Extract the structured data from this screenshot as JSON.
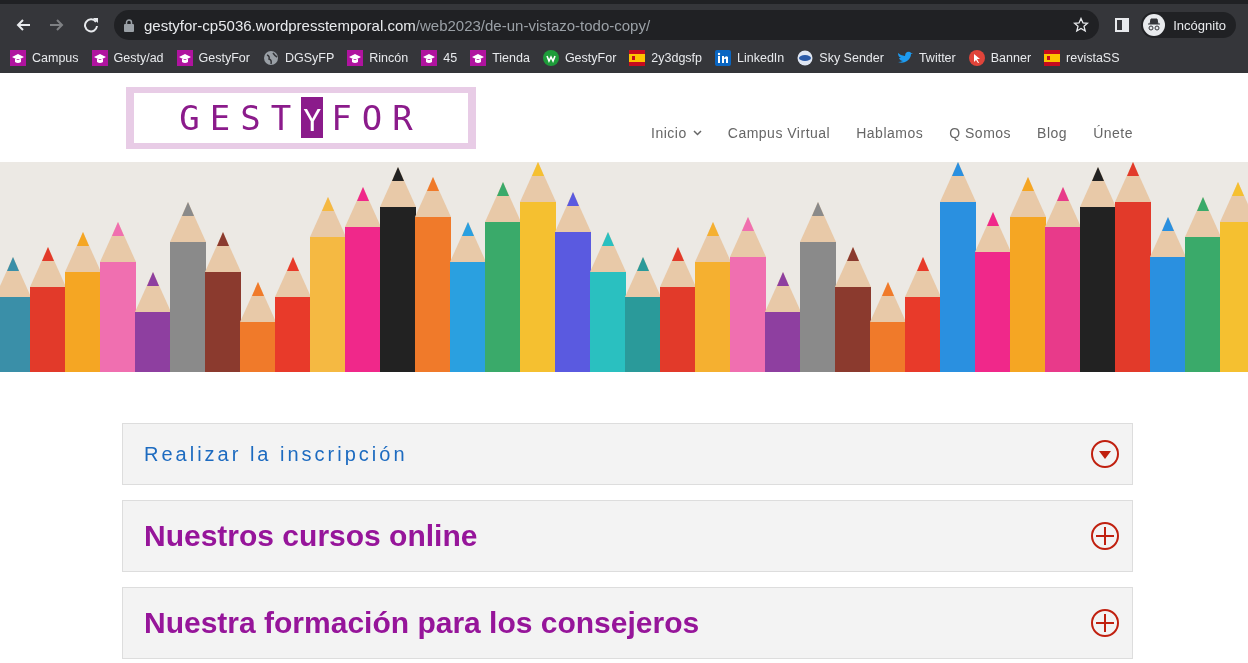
{
  "browser": {
    "url_host": "gestyfor-cp5036.wordpresstemporal.com",
    "url_path": "/web2023/de-un-vistazo-todo-copy/",
    "profile": "Incógnito"
  },
  "bookmarks": [
    {
      "label": "Campus",
      "kind": "cap"
    },
    {
      "label": "Gesty/ad",
      "kind": "cap"
    },
    {
      "label": "GestyFor",
      "kind": "cap"
    },
    {
      "label": "DGSyFP",
      "kind": "globe"
    },
    {
      "label": "Rincón",
      "kind": "cap"
    },
    {
      "label": "45",
      "kind": "cap"
    },
    {
      "label": "Tienda",
      "kind": "cap"
    },
    {
      "label": "GestyFor",
      "kind": "w"
    },
    {
      "label": "2y3dgsfp",
      "kind": "flag"
    },
    {
      "label": "LinkedIn",
      "kind": "in"
    },
    {
      "label": "Sky Sender",
      "kind": "sky"
    },
    {
      "label": "Twitter",
      "kind": "bird"
    },
    {
      "label": "Banner",
      "kind": "banner"
    },
    {
      "label": "revistaSS",
      "kind": "flag"
    }
  ],
  "logo": {
    "left": "GEST",
    "middle": "Y",
    "right": "FOR"
  },
  "nav": [
    {
      "label": "Inicio",
      "has_menu": true
    },
    {
      "label": "Campus Virtual",
      "has_menu": false
    },
    {
      "label": "Hablamos",
      "has_menu": false
    },
    {
      "label": "Q Somos",
      "has_menu": false
    },
    {
      "label": "Blog",
      "has_menu": false
    },
    {
      "label": "Únete",
      "has_menu": false
    }
  ],
  "accordions": [
    {
      "title": "Realizar la inscripción",
      "kind": "dropdown"
    },
    {
      "title": "Nuestros cursos online",
      "kind": "plus"
    },
    {
      "title": "Nuestra formación para los consejeros",
      "kind": "plus"
    }
  ]
}
